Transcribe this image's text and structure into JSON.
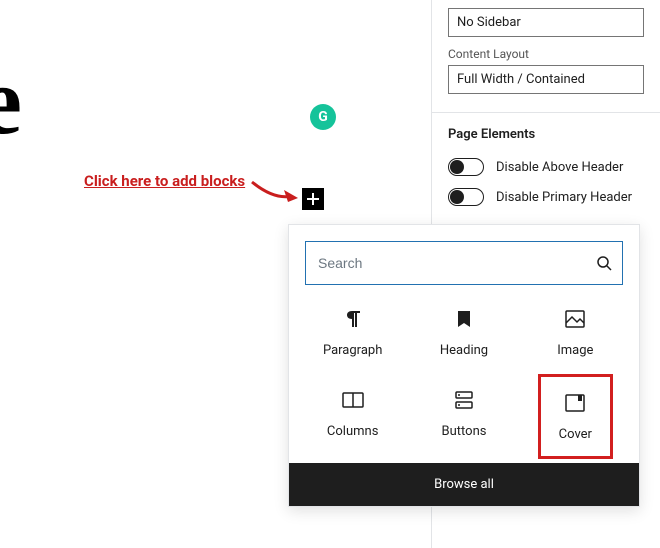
{
  "editor": {
    "title_fragment": "itle",
    "annotation": "Click here to add blocks",
    "add_block_button_label": "Add block"
  },
  "badge": {
    "letter": "G"
  },
  "sidebar": {
    "sidebar_layout_value": "No Sidebar",
    "content_layout_label": "Content Layout",
    "content_layout_value": "Full Width / Contained",
    "page_elements_title": "Page Elements",
    "toggles": [
      {
        "label": "Disable Above Header",
        "on": false
      },
      {
        "label": "Disable Primary Header",
        "on": false
      }
    ]
  },
  "inserter": {
    "search_placeholder": "Search",
    "blocks": [
      {
        "name": "Paragraph"
      },
      {
        "name": "Heading"
      },
      {
        "name": "Image"
      },
      {
        "name": "Columns"
      },
      {
        "name": "Buttons"
      },
      {
        "name": "Cover"
      }
    ],
    "browse_all": "Browse all"
  }
}
